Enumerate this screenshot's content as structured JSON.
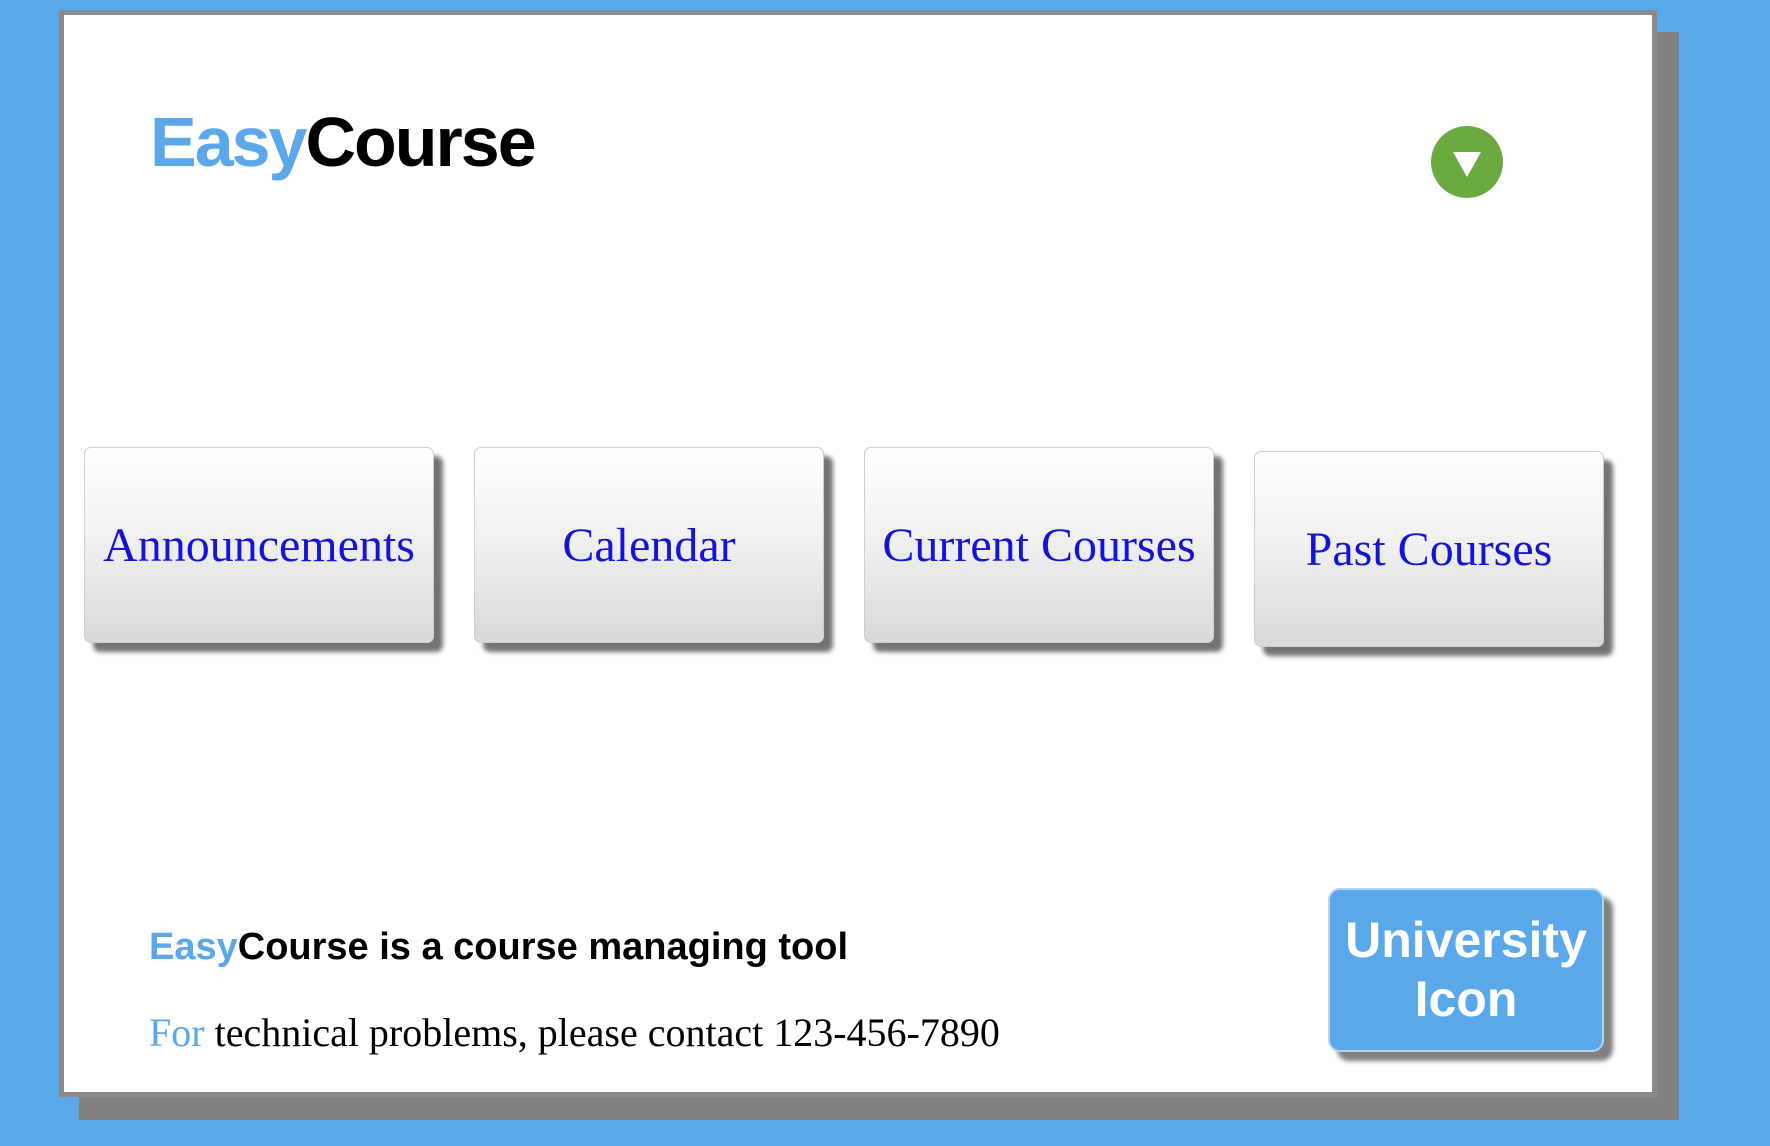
{
  "brand": {
    "easy": "Easy",
    "course": "Course"
  },
  "header": {
    "menu_icon": "chevron-down-icon",
    "menu_icon_color": "#6aaa3e"
  },
  "nav": {
    "items": [
      {
        "label": "Announcements"
      },
      {
        "label": "Calendar"
      },
      {
        "label": "Current Courses"
      },
      {
        "label": "Past Courses"
      }
    ]
  },
  "footer": {
    "tagline_rest": "Course is a course managing tool",
    "contact_for": "For",
    "contact_rest": " technical problems, please contact 123-456-7890"
  },
  "university": {
    "line1": "University",
    "line2": "Icon"
  },
  "colors": {
    "accent": "#5aa7ea",
    "link": "#1414d8",
    "menu": "#6aaa3e"
  }
}
